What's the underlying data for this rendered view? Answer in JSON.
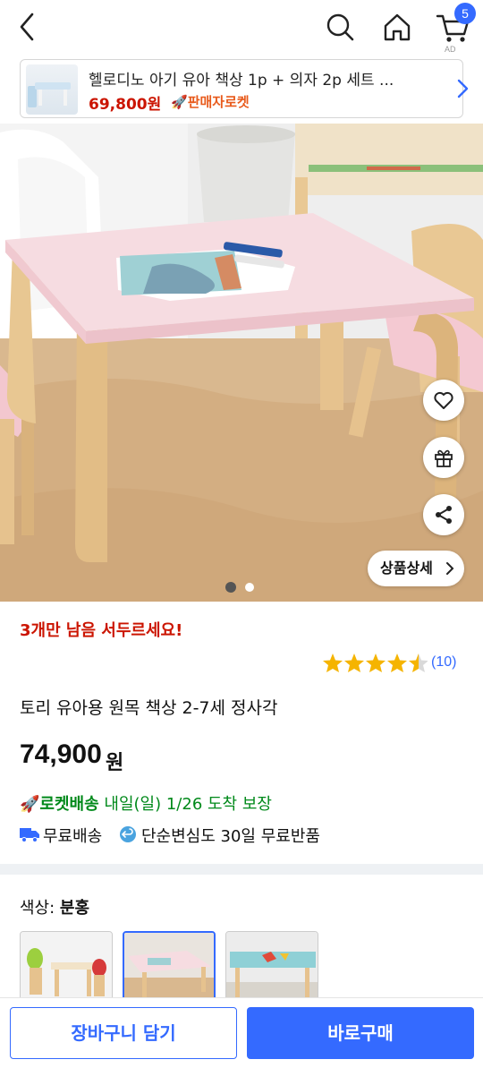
{
  "colors": {
    "accent": "#346aff",
    "price_red": "#cb1400",
    "rocket_green": "#00891a",
    "star": "#f5b400",
    "table_pink": "#f8dfe4",
    "wood": "#e6c28e"
  },
  "header": {
    "cart_count": "5",
    "icons": [
      "back-arrow-icon",
      "search-icon",
      "home-icon",
      "cart-icon"
    ]
  },
  "banner": {
    "title": "헬로디노 아기 유아 책상 1p + 의자 2p 세트 ...",
    "price": "69,800원",
    "seller_badge": "판매자로켓"
  },
  "gallery": {
    "image_count": 2,
    "current_index": 1,
    "detail_button": "상품상세"
  },
  "product": {
    "stock_notice": "3개만 남음 서두르세요!",
    "rating": 4.5,
    "review_count": "(10)",
    "title": "토리 유아용 원목 책상 2-7세 정사각",
    "price": "74,900",
    "price_unit": "원",
    "rocket_label": "로켓배송",
    "delivery": "내일(일) 1/26 도착 보장",
    "free_shipping": "무료배송",
    "free_return": "단순변심도 30일 무료반품"
  },
  "options": {
    "label": "색상:",
    "selected": "분홍",
    "swatch_count": 3,
    "selected_index": 2
  },
  "actions": {
    "cart_button": "장바구니 담기",
    "buy_button": "바로구매"
  }
}
